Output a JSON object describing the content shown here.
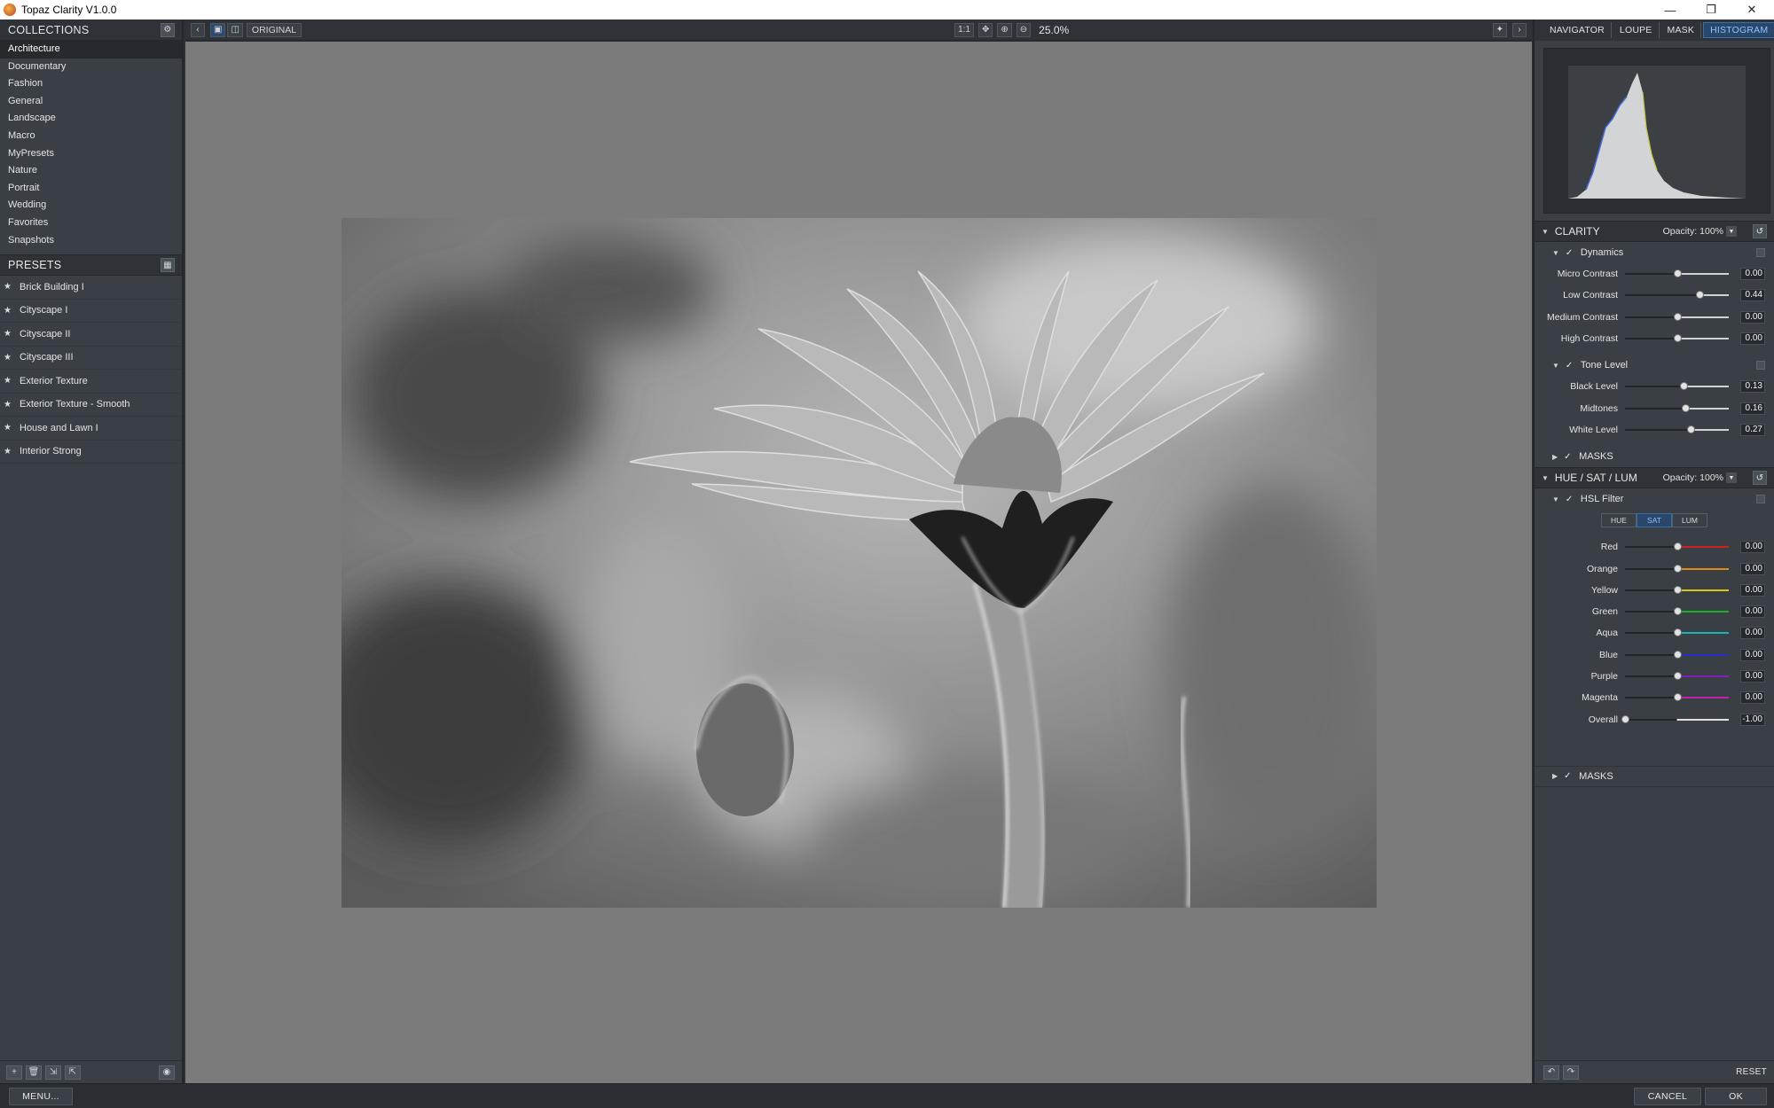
{
  "window": {
    "title": "Topaz Clarity V1.0.0"
  },
  "collections": {
    "heading": "COLLECTIONS",
    "items": [
      "Architecture",
      "Documentary",
      "Fashion",
      "General",
      "Landscape",
      "Macro",
      "MyPresets",
      "Nature",
      "Portrait",
      "Wedding",
      "Favorites",
      "Snapshots"
    ],
    "selected": "Architecture"
  },
  "presets": {
    "heading": "PRESETS",
    "items": [
      "Brick Building I",
      "Cityscape I",
      "Cityscape II",
      "Cityscape III",
      "Exterior Texture",
      "Exterior Texture - Smooth",
      "House and Lawn I",
      "Interior Strong"
    ]
  },
  "toolbar": {
    "original_label": "ORIGINAL",
    "zoom": "25.0%"
  },
  "right_tabs": {
    "items": [
      "NAVIGATOR",
      "LOUPE",
      "MASK",
      "HISTOGRAM"
    ],
    "active": "HISTOGRAM"
  },
  "clarity": {
    "title": "CLARITY",
    "opacity_label": "Opacity:",
    "opacity": "100%",
    "dynamics": {
      "label": "Dynamics",
      "sliders": [
        {
          "label": "Micro Contrast",
          "value": "0.00",
          "pos": 0.5
        },
        {
          "label": "Low Contrast",
          "value": "0.44",
          "pos": 0.72
        },
        {
          "label": "Medium Contrast",
          "value": "0.00",
          "pos": 0.5
        },
        {
          "label": "High Contrast",
          "value": "0.00",
          "pos": 0.5
        }
      ]
    },
    "tone": {
      "label": "Tone Level",
      "sliders": [
        {
          "label": "Black Level",
          "value": "0.13",
          "pos": 0.565
        },
        {
          "label": "Midtones",
          "value": "0.16",
          "pos": 0.58
        },
        {
          "label": "White Level",
          "value": "0.27",
          "pos": 0.635
        }
      ]
    },
    "masks_label": "MASKS"
  },
  "hsl": {
    "title": "HUE / SAT / LUM",
    "opacity_label": "Opacity:",
    "opacity": "100%",
    "filter_label": "HSL Filter",
    "modes": [
      "HUE",
      "SAT",
      "LUM"
    ],
    "active_mode": "SAT",
    "sliders": [
      {
        "label": "Red",
        "value": "0.00",
        "pos": 0.5,
        "color": "#d02020"
      },
      {
        "label": "Orange",
        "value": "0.00",
        "pos": 0.5,
        "color": "#e08a10"
      },
      {
        "label": "Yellow",
        "value": "0.00",
        "pos": 0.5,
        "color": "#d8c816"
      },
      {
        "label": "Green",
        "value": "0.00",
        "pos": 0.5,
        "color": "#18b428"
      },
      {
        "label": "Aqua",
        "value": "0.00",
        "pos": 0.5,
        "color": "#16b4b4"
      },
      {
        "label": "Blue",
        "value": "0.00",
        "pos": 0.5,
        "color": "#2030c8"
      },
      {
        "label": "Purple",
        "value": "0.00",
        "pos": 0.5,
        "color": "#8020c0"
      },
      {
        "label": "Magenta",
        "value": "0.00",
        "pos": 0.5,
        "color": "#c020b0"
      },
      {
        "label": "Overall",
        "value": "-1.00",
        "pos": 0.0,
        "color": "#e0e2e4"
      }
    ],
    "masks_label": "MASKS"
  },
  "right_bottom": {
    "reset_label": "RESET"
  },
  "status": {
    "menu_label": "MENU...",
    "cancel_label": "CANCEL",
    "ok_label": "OK"
  }
}
